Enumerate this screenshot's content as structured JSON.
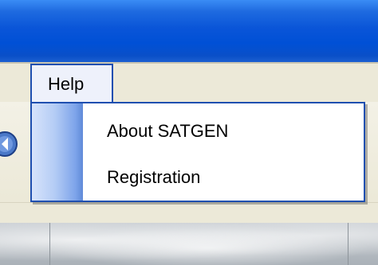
{
  "menubar": {
    "help_label": "Help"
  },
  "help_menu": {
    "items": [
      {
        "label": "About SATGEN"
      },
      {
        "label": "Registration"
      }
    ]
  },
  "colors": {
    "titlebar_blue": "#0050d6",
    "menu_border": "#1f4fb0",
    "window_face": "#ece9d8"
  }
}
